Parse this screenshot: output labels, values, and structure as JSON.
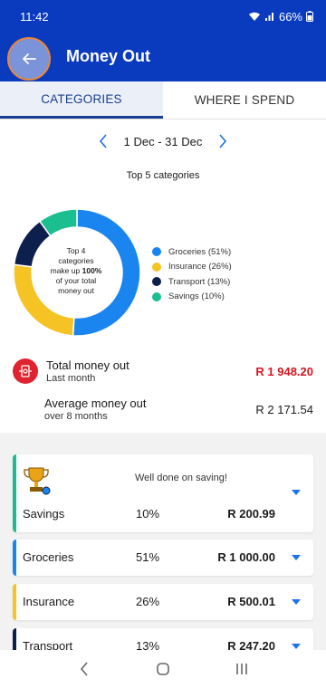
{
  "status": {
    "time": "11:42",
    "battery": "66%"
  },
  "header": {
    "title": "Money Out"
  },
  "tabs": [
    {
      "label": "CATEGORIES",
      "active": true
    },
    {
      "label": "WHERE I SPEND",
      "active": false
    }
  ],
  "period": {
    "label": "1 Dec - 31 Dec"
  },
  "chart_section": {
    "title": "Top 5 categories"
  },
  "chart_data": {
    "type": "pie",
    "categories": [
      "Groceries",
      "Insurance",
      "Transport",
      "Savings"
    ],
    "values": [
      51,
      26,
      13,
      10
    ],
    "colors": [
      "#1a85ef",
      "#f6c324",
      "#0c1f4d",
      "#1bbf8f"
    ],
    "legend": [
      "Groceries (51%)",
      "Insurance (26%)",
      "Transport (13%)",
      "Savings (10%)"
    ],
    "center_text": [
      "Top 4",
      "categories",
      "make up",
      "100%",
      "of your total",
      "money out"
    ]
  },
  "summary": {
    "total_label": "Total money out",
    "total_sub": "Last month",
    "total_value": "R 1 948.20",
    "avg_label": "Average money out",
    "avg_sub": "over 8 months",
    "avg_value": "R 2 171.54"
  },
  "cards": [
    {
      "name": "Savings",
      "pct": "10%",
      "amount": "R 200.99",
      "color": "#1bbf8f",
      "note": "Well done on saving!"
    },
    {
      "name": "Groceries",
      "pct": "51%",
      "amount": "R 1 000.00",
      "color": "#1a85ef"
    },
    {
      "name": "Insurance",
      "pct": "26%",
      "amount": "R 500.01",
      "color": "#f6c324"
    },
    {
      "name": "Transport",
      "pct": "13%",
      "amount": "R 247.20",
      "color": "#0c1f4d"
    }
  ]
}
